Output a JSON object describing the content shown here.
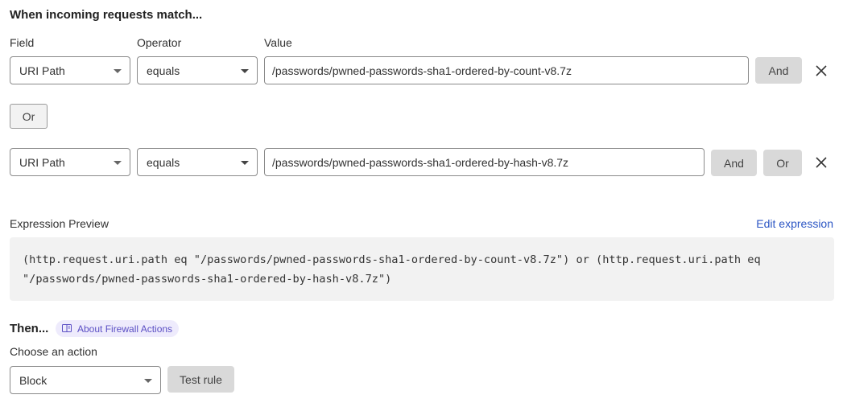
{
  "title": "When incoming requests match...",
  "columns": {
    "field": "Field",
    "operator": "Operator",
    "value": "Value"
  },
  "conditions": [
    {
      "field": "URI Path",
      "operator": "equals",
      "value": "/passwords/pwned-passwords-sha1-ordered-by-count-v8.7z",
      "buttons": [
        "And"
      ]
    },
    {
      "field": "URI Path",
      "operator": "equals",
      "value": "/passwords/pwned-passwords-sha1-ordered-by-hash-v8.7z",
      "buttons": [
        "And",
        "Or"
      ]
    }
  ],
  "or_separator": "Or",
  "expression_preview": {
    "label": "Expression Preview",
    "edit_link": "Edit expression",
    "line1": "(http.request.uri.path eq \"/passwords/pwned-passwords-sha1-ordered-by-count-v8.7z\") or (http.request.uri.path eq",
    "line2": "\"/passwords/pwned-passwords-sha1-ordered-by-hash-v8.7z\")"
  },
  "then": {
    "heading": "Then...",
    "about_link": "About Firewall Actions",
    "choose_label": "Choose an action",
    "action": "Block",
    "test_button": "Test rule"
  },
  "colors": {
    "link": "#2c56c4",
    "pill_bg": "#eeebfc",
    "pill_text": "#5b4fc4",
    "button_bg": "#d9d9d9",
    "preview_bg": "#f2f2f2"
  }
}
